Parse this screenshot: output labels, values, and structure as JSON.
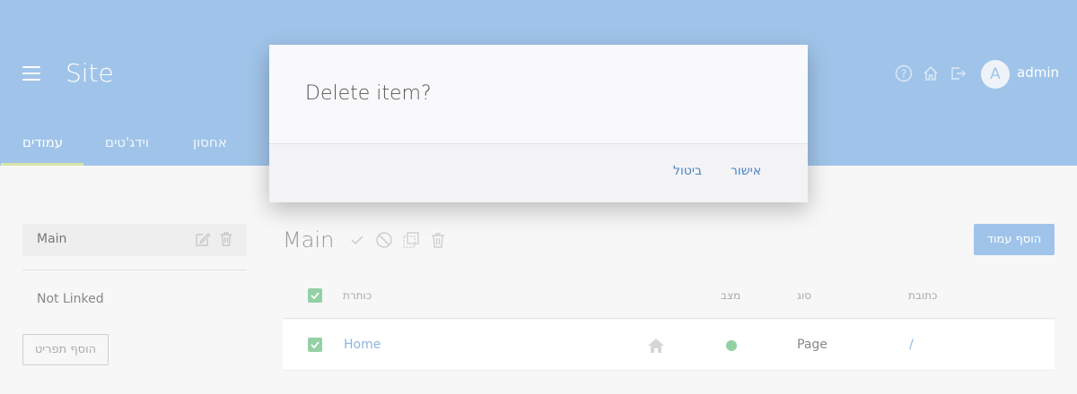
{
  "header": {
    "site_title": "Site",
    "username": "admin",
    "avatar_initial": "A",
    "icons": [
      "help-icon",
      "home-icon",
      "logout-icon"
    ]
  },
  "tabs": [
    {
      "label": "עמודים",
      "active": true
    },
    {
      "label": "וידג'טים",
      "active": false
    },
    {
      "label": "אחסון",
      "active": false
    }
  ],
  "sidebar": {
    "main_label": "Main",
    "not_linked_label": "Not Linked",
    "add_menu_label": "הוסף תפריט"
  },
  "main": {
    "title": "Main",
    "add_page_label": "הוסף עמוד",
    "columns": {
      "title": "כותרת",
      "status": "מצב",
      "type": "סוג",
      "url": "כתובת"
    },
    "rows": [
      {
        "title": "Home",
        "type": "Page",
        "url": "/"
      }
    ]
  },
  "modal": {
    "title": "Delete item?",
    "confirm_label": "אישור",
    "cancel_label": "ביטול"
  },
  "colors": {
    "header_bg": "#a0c4e9",
    "accent_green": "#93d1a5",
    "link_blue": "#4b84c5"
  }
}
